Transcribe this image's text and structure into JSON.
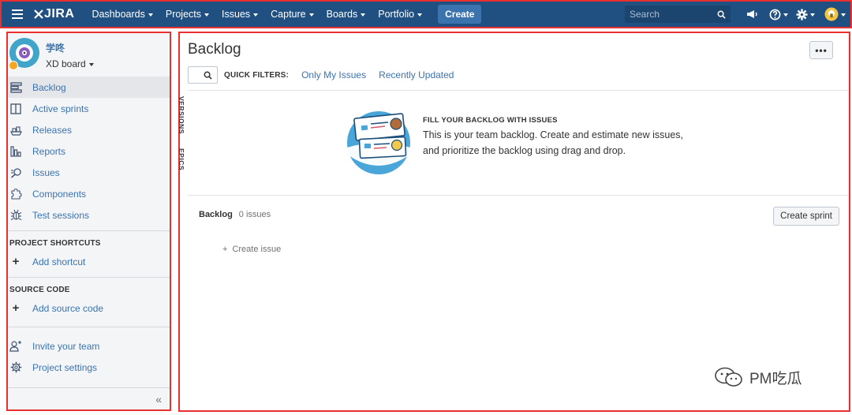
{
  "topbar": {
    "logo_text": "JIRA",
    "nav": [
      {
        "label": "Dashboards"
      },
      {
        "label": "Projects"
      },
      {
        "label": "Issues"
      },
      {
        "label": "Capture"
      },
      {
        "label": "Boards"
      },
      {
        "label": "Portfolio"
      }
    ],
    "create_label": "Create",
    "search_placeholder": "Search",
    "colors": {
      "bar": "#205081",
      "create": "#3b73af",
      "highlight": "#e8302f"
    }
  },
  "sidebar": {
    "project_name": "学咚",
    "board_label": "XD board",
    "items": [
      {
        "label": "Backlog",
        "icon": "backlog-icon",
        "active": true
      },
      {
        "label": "Active sprints",
        "icon": "board-columns-icon"
      },
      {
        "label": "Releases",
        "icon": "ship-icon"
      },
      {
        "label": "Reports",
        "icon": "bar-chart-icon"
      },
      {
        "label": "Issues",
        "icon": "issues-search-icon"
      },
      {
        "label": "Components",
        "icon": "puzzle-icon"
      },
      {
        "label": "Test sessions",
        "icon": "bug-icon"
      }
    ],
    "shortcuts_title": "PROJECT SHORTCUTS",
    "add_shortcut": "Add shortcut",
    "source_title": "SOURCE CODE",
    "add_source": "Add source code",
    "invite_team": "Invite your team",
    "project_settings": "Project settings",
    "collapse_glyph": "«"
  },
  "main": {
    "title": "Backlog",
    "more_glyph": "•••",
    "vertical_tabs": [
      "VERSIONS",
      "EPICS"
    ],
    "quick_filters_label": "QUICK FILTERS:",
    "quick_filters": [
      "Only My Issues",
      "Recently Updated"
    ],
    "empty_title": "FILL YOUR BACKLOG WITH ISSUES",
    "empty_line1": "This is your team backlog. Create and estimate new issues,",
    "empty_line2": "and prioritize the backlog using drag and drop.",
    "backlog_label": "Backlog",
    "issue_count": "0 issues",
    "create_sprint": "Create sprint",
    "create_issue_plus": "+",
    "create_issue": "Create issue"
  },
  "watermark": {
    "text": "PM吃瓜"
  }
}
